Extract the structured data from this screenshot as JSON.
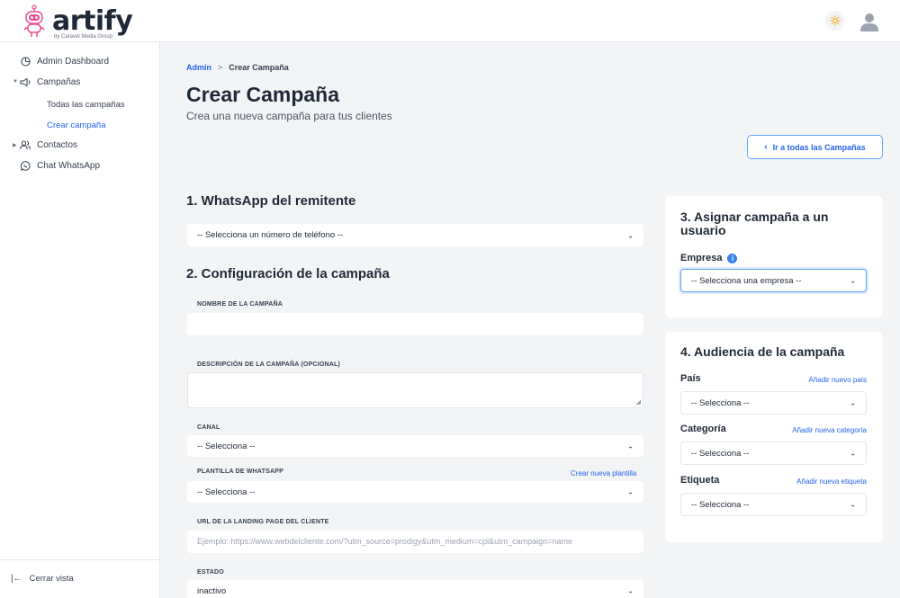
{
  "brand": {
    "name": "artify",
    "sub": "by Caravel Media Group"
  },
  "sidebar": {
    "items": [
      {
        "label": "Admin Dashboard"
      },
      {
        "label": "Campañas",
        "children": [
          {
            "label": "Todas las campañas"
          },
          {
            "label": "Crear campaña",
            "active": true
          }
        ]
      },
      {
        "label": "Contactos"
      },
      {
        "label": "Chat WhatsApp"
      }
    ],
    "collapse_label": "Cerrar vista"
  },
  "breadcrumb": {
    "parent": "Admin",
    "separator": ">",
    "current": "Crear Campaña"
  },
  "page": {
    "title": "Crear Campaña",
    "subtitle": "Crea una nueva campaña para tus clientes",
    "back_button": "Ir a todas las Campañas"
  },
  "section1": {
    "title": "1. WhatsApp del remitente",
    "phone_select": "-- Selecciona un número de teléfono --"
  },
  "section2": {
    "title": "2. Configuración de la campaña",
    "name_label": "NOMBRE DE LA CAMPAÑA",
    "desc_label": "DESCRIPCIÓN DE LA CAMPAÑA (OPCIONAL)",
    "channel_label": "CANAL",
    "channel_value": "-- Selecciona --",
    "template_label": "PLANTILLA DE WHATSAPP",
    "template_link": "Crear nueva plantilla",
    "template_value": "-- Selecciona --",
    "url_label": "URL DE LA LANDING PAGE DEL CLIENTE",
    "url_placeholder": "Ejemplo: https://www.webdelcliente.com/?utm_source=prodigy&utm_medium=cpl&utm_campaign=name",
    "status_label": "ESTADO",
    "status_value": "inactivo"
  },
  "section3": {
    "title": "3. Asignar campaña a un usuario",
    "company_label": "Empresa",
    "company_select": "-- Selecciona una empresa --"
  },
  "section4": {
    "title": "4. Audiencia de la campaña",
    "country_label": "País",
    "country_link": "Añadir nuevo país",
    "country_value": "-- Selecciona --",
    "category_label": "Categoría",
    "category_link": "Añadir nueva categoría",
    "category_value": "-- Selecciona --",
    "tag_label": "Etiqueta",
    "tag_link": "Añadir nueva etiqueta",
    "tag_value": "-- Selecciona --"
  },
  "colors": {
    "accent": "#2563eb",
    "background": "#f3f4f6",
    "brand_pink": "#e74c8b"
  }
}
